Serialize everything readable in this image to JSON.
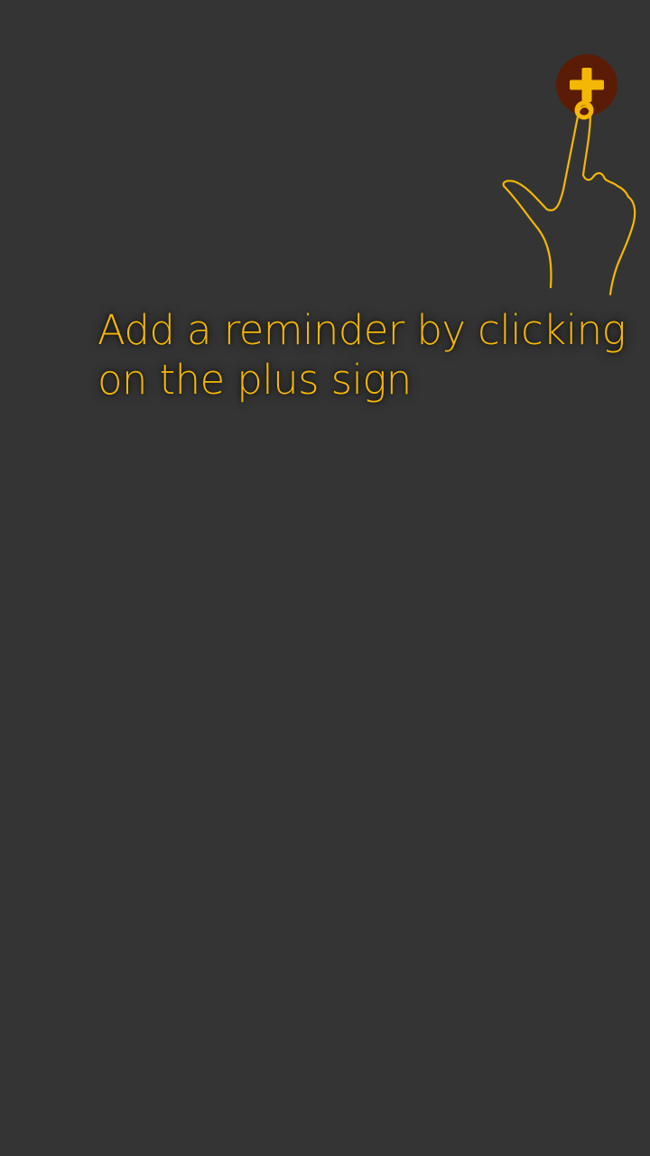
{
  "screen": {
    "background_color": "#343434"
  },
  "add_button": {
    "icon": "plus-icon",
    "background_color": "#5a1c06",
    "icon_color": "#f4b704"
  },
  "tutorial": {
    "gesture_icon": "pointing-hand-icon",
    "accent_color": "#f4b704",
    "hint_line_1": "Add a reminder by clicking",
    "hint_line_2": "on the plus sign"
  }
}
